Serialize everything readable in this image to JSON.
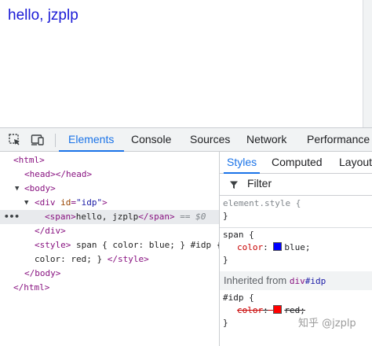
{
  "page": {
    "heading_text": "hello, jzplp"
  },
  "devtools": {
    "tabs": [
      "Elements",
      "Console",
      "Sources",
      "Network",
      "Performance"
    ],
    "active_tab": "Elements",
    "toolbar_icons": [
      "inspect-element-icon",
      "device-toolbar-icon"
    ]
  },
  "dom_tree": {
    "html_open": "<html>",
    "head": "<head></head>",
    "body_open": "<body>",
    "div_tag_open": "<div",
    "div_attr_name": "id",
    "div_attr_value": "\"idp\"",
    "div_tag_close": ">",
    "span_open": "<span>",
    "span_text": "hello, jzplp",
    "span_close": "</span>",
    "selected_marker": "== $0",
    "ellipsis": "•••",
    "div_close": "</div>",
    "style_open": "<style>",
    "style_text_1": " span { color: blue; } #idp {",
    "style_text_2": "color: red; } ",
    "style_close": "</style>",
    "body_close": "</body>",
    "html_close": "</html>"
  },
  "styles_panel": {
    "subtabs": [
      "Styles",
      "Computed",
      "Layout"
    ],
    "active_subtab": "Styles",
    "filter_label": "Filter",
    "rules": {
      "element_style": {
        "selector": "element.style {",
        "close": "}"
      },
      "span_rule": {
        "selector": "span {",
        "property": "color",
        "colon": ":",
        "value": "blue",
        "semicolon": ";",
        "swatch_color": "#0000ff",
        "close": "}"
      },
      "inherited": {
        "label": "Inherited from",
        "tag": "div",
        "id": "#idp"
      },
      "idp_rule": {
        "selector": "#idp {",
        "property": "color",
        "colon": ":",
        "value": "red",
        "semicolon": ";",
        "swatch_color": "#ff0000",
        "overridden": true,
        "close": "}"
      }
    }
  },
  "watermark": "知乎 @jzplp",
  "colors": {
    "accent": "#1a73e8",
    "tag": "#881280",
    "attr_name": "#994500",
    "attr_value": "#1a1aa6",
    "css_property": "#c80000"
  }
}
